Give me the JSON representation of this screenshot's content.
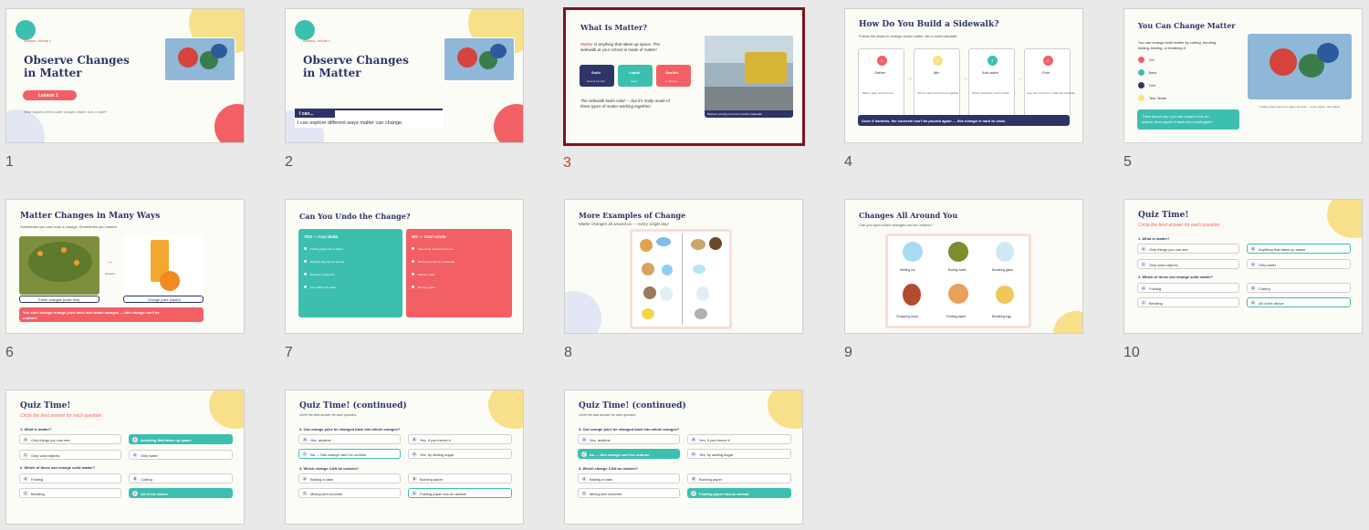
{
  "slides": [
    {
      "num": "1",
      "kicker": "SCIENCE • GRADE 3",
      "title_line1": "Observe Changes",
      "title_line2": "in Matter",
      "badge": "Lesson 1",
      "caption": "What happens when matter changes shape, size, or state?"
    },
    {
      "num": "2",
      "kicker": "SCIENCE • GRADE 3",
      "title_line1": "Observe Changes",
      "title_line2": "in Matter",
      "ican_label": "I can...",
      "ican_text": "I can explore different ways matter can change."
    },
    {
      "num": "3",
      "title": "What Is Matter?",
      "intro_word": "Matter",
      "intro_rest1": " is anything that takes up space. The",
      "intro_rest2": "sidewalk at your school is made of matter!",
      "states": [
        {
          "label": "Solid",
          "sub": "sand & cement"
        },
        {
          "label": "Liquid",
          "sub": "water"
        },
        {
          "label": "Gas/Air",
          "sub": "in mixture"
        }
      ],
      "note_line1": "The sidewalk looks solid — but it's really made of",
      "note_line2": "three types of matter working together!",
      "photo_caption": "Workers pouring concrete to build a sidewalk"
    },
    {
      "num": "4",
      "title": "How Do You Build a Sidewalk?",
      "subtitle": "Follow the steps to change loose matter into a solid sidewalk.",
      "steps": [
        {
          "n": "1",
          "label": "Gather",
          "desc": "Water, sand, and cement"
        },
        {
          "n": "2",
          "label": "Mix",
          "desc": "Stir the sand and cement together"
        },
        {
          "n": "3",
          "label": "Add water",
          "desc": "Slowly add water until it's thick"
        },
        {
          "n": "4",
          "label": "Pour",
          "desc": "Pour the concrete to make the sidewalk"
        }
      ],
      "banner": "Once it hardens, the concrete can't be poured again — this change is hard to undo."
    },
    {
      "num": "5",
      "title": "You Can Change Matter",
      "body1": "You can change solid matter by cutting, bending,",
      "body2": "folding, tearing, or breaking it.",
      "items": [
        {
          "letter": "C",
          "label": "Cut"
        },
        {
          "letter": "B",
          "label": "Bend"
        },
        {
          "letter": "F",
          "label": "Fold"
        },
        {
          "letter": "T",
          "label": "Tear / Break"
        }
      ],
      "callout1": "Think about clay: you can shape it into an",
      "callout2": "animal, then squish it back into a ball again!",
      "photo_caption": "Folding paper becomes paper animals — same paper, new shape!"
    },
    {
      "num": "6",
      "title": "Matter Changes in Many Ways",
      "subtitle": "Sometimes you can undo a change. Sometimes you cannot.",
      "left_label": "Fresh oranges (solid fruit)",
      "right_label": "Orange juice (liquid)",
      "arrow_label": "squeeze",
      "banner1": "You can't change orange juice back into whole oranges — this change can't be",
      "banner2": "undone!"
    },
    {
      "num": "7",
      "title": "Can You Undo the Change?",
      "yes_title": "YES — Can Undo",
      "yes_items": [
        "Folding paper into a shape",
        "Shaping clay into an animal",
        "Bending a paperclip",
        "Ice melting into water"
      ],
      "no_title": "NO — Can't Undo",
      "no_items": [
        "Squeezing oranges into juice",
        "Mixing concrete for a sidewalk",
        "Baking a cake",
        "Burning paper"
      ]
    },
    {
      "num": "8",
      "title": "More Examples of Change",
      "subtitle": "Matter changes all around us — every single day!"
    },
    {
      "num": "9",
      "title": "Changes All Around You",
      "subtitle": "Can you spot which changes can be undone?",
      "items": [
        "Melting ice",
        "Boiling water",
        "Breaking glass",
        "Chopping wood",
        "Folding paper",
        "Breaking egg"
      ]
    },
    {
      "num": "10",
      "title": "Quiz Time!",
      "subtitle": "Circle the best answer for each question.",
      "q1": "1. What is matter?",
      "q1_opts": [
        {
          "l": "A",
          "t": "Only things you can see"
        },
        {
          "l": "B",
          "t": "Anything that takes up space"
        },
        {
          "l": "C",
          "t": "Only solid objects"
        },
        {
          "l": "D",
          "t": "Only water"
        }
      ],
      "q2": "2. Which of these can change solid matter?",
      "q2_opts": [
        {
          "l": "A",
          "t": "Folding"
        },
        {
          "l": "B",
          "t": "Cutting"
        },
        {
          "l": "C",
          "t": "Bending"
        },
        {
          "l": "D",
          "t": "All of the above"
        }
      ]
    },
    {
      "num": "11",
      "title": "Quiz Time!",
      "subtitle": "Circle the best answer for each question.",
      "q1": "1. What is matter?",
      "q1_opts": [
        {
          "l": "A",
          "t": "Only things you can see"
        },
        {
          "l": "✓",
          "t": "Anything that takes up space"
        },
        {
          "l": "C",
          "t": "Only solid objects"
        },
        {
          "l": "D",
          "t": "Only water"
        }
      ],
      "q2": "2. Which of these can change solid matter?",
      "q2_opts": [
        {
          "l": "A",
          "t": "Folding"
        },
        {
          "l": "B",
          "t": "Cutting"
        },
        {
          "l": "C",
          "t": "Bending"
        },
        {
          "l": "✓",
          "t": "All of the above"
        }
      ]
    },
    {
      "num": "12",
      "title": "Quiz Time! (continued)",
      "subtitle": "Circle the best answer for each question.",
      "q3": "3. Can orange juice be changed back into whole oranges?",
      "q3_opts": [
        {
          "l": "A",
          "t": "Yes, anytime"
        },
        {
          "l": "B",
          "t": "Yes, if you freeze it"
        },
        {
          "l": "C",
          "t": "No — this change can't be undone"
        },
        {
          "l": "D",
          "t": "Yes, by adding sugar"
        }
      ],
      "q4": "4. Which change CAN be undone?",
      "q4_opts": [
        {
          "l": "A",
          "t": "Baking a cake"
        },
        {
          "l": "B",
          "t": "Burning paper"
        },
        {
          "l": "C",
          "t": "Mixing wet concrete"
        },
        {
          "l": "D",
          "t": "Folding paper into an animal"
        }
      ]
    },
    {
      "num": "13",
      "title": "Quiz Time! (continued)",
      "subtitle": "Circle the best answer for each question.",
      "q3": "3. Can orange juice be changed back into whole oranges?",
      "q3_opts": [
        {
          "l": "A",
          "t": "Yes, anytime"
        },
        {
          "l": "B",
          "t": "Yes, if you freeze it"
        },
        {
          "l": "✓",
          "t": "No — this change can't be undone"
        },
        {
          "l": "D",
          "t": "Yes, by adding sugar"
        }
      ],
      "q4": "4. Which change CAN be undone?",
      "q4_opts": [
        {
          "l": "A",
          "t": "Baking a cake"
        },
        {
          "l": "B",
          "t": "Burning paper"
        },
        {
          "l": "C",
          "t": "Mixing wet concrete"
        },
        {
          "l": "✓",
          "t": "Folding paper into an animal"
        }
      ]
    }
  ],
  "colors": {
    "navy": "#2c3468",
    "coral": "#f26065",
    "teal": "#3dbfaf",
    "yellow": "#f8e08a",
    "selected": "#7a1420"
  }
}
